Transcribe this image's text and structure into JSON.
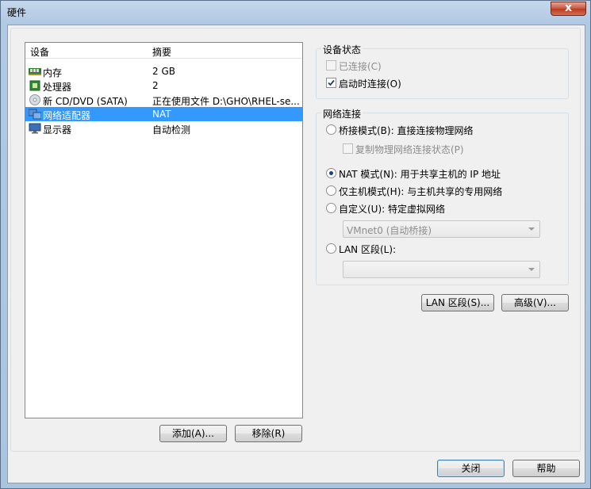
{
  "window": {
    "title": "硬件",
    "close_glyph": "x"
  },
  "device_list": {
    "columns": [
      "设备",
      "摘要"
    ],
    "rows": [
      {
        "device": "内存",
        "summary": "2 GB",
        "icon": "memory-icon"
      },
      {
        "device": "处理器",
        "summary": "2",
        "icon": "processor-icon"
      },
      {
        "device": "新 CD/DVD (SATA)",
        "summary": "正在使用文件 D:\\GHO\\RHEL-se...",
        "icon": "cd-dvd-icon"
      },
      {
        "device": "网络适配器",
        "summary": "NAT",
        "icon": "network-adapter-icon",
        "selected": true
      },
      {
        "device": "显示器",
        "summary": "自动检测",
        "icon": "display-icon"
      }
    ],
    "add_button": "添加(A)...",
    "remove_button": "移除(R)"
  },
  "device_status": {
    "title": "设备状态",
    "connected": {
      "label": "已连接(C)",
      "checked": false,
      "disabled": true
    },
    "connect_at_power_on": {
      "label": "启动时连接(O)",
      "checked": true
    }
  },
  "network_connection": {
    "title": "网络连接",
    "bridged": {
      "label": "桥接模式(B): 直接连接物理网络",
      "selected": false
    },
    "replicate": {
      "label": "复制物理网络连接状态(P)",
      "checked": false,
      "disabled": true
    },
    "nat": {
      "label": "NAT 模式(N): 用于共享主机的 IP 地址",
      "selected": true
    },
    "host_only": {
      "label": "仅主机模式(H): 与主机共享的专用网络",
      "selected": false
    },
    "custom": {
      "label": "自定义(U): 特定虚拟网络",
      "selected": false
    },
    "custom_combo": {
      "value": "VMnet0 (自动桥接)"
    },
    "lan_segment": {
      "label": "LAN 区段(L):",
      "selected": false
    },
    "lan_combo": {
      "value": ""
    }
  },
  "buttons": {
    "lan_segments": "LAN 区段(S)...",
    "advanced": "高级(V)...",
    "close": "关闭",
    "help": "帮助"
  },
  "colors": {
    "selection": "#3399ff",
    "title_bar": "#b2c9e3"
  }
}
